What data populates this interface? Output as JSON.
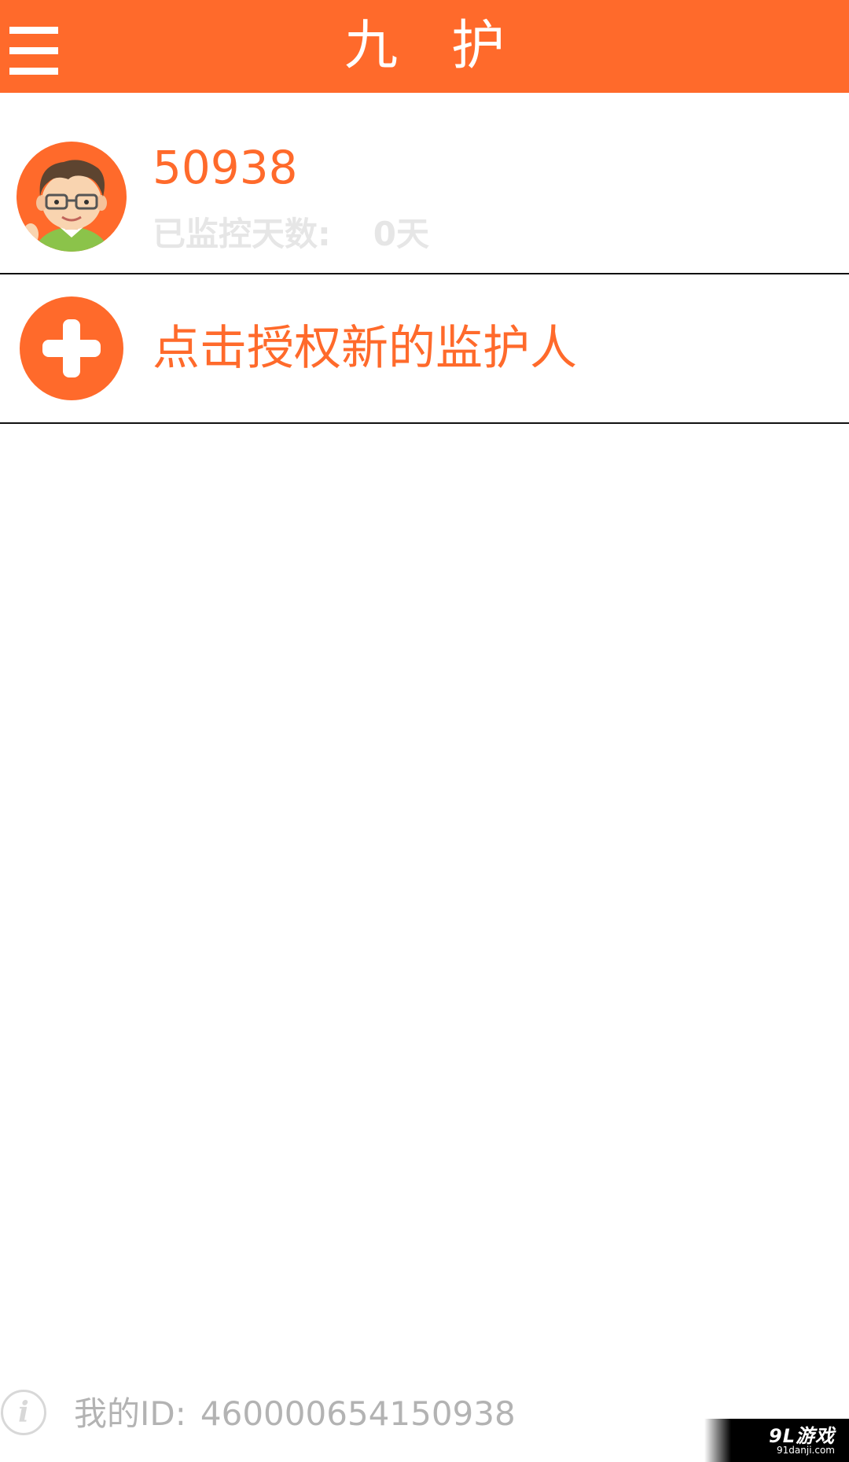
{
  "header": {
    "title": "九护",
    "menu_icon": "menu-icon"
  },
  "user": {
    "name": "50938",
    "days_label": "已监控天数:",
    "days_value": "0天",
    "avatar_icon": "avatar-old-man-glasses"
  },
  "add_guardian": {
    "label": "点击授权新的监护人",
    "icon": "plus-icon"
  },
  "footer": {
    "id_label": "我的ID:",
    "id_value": "460000654150938",
    "icon": "info-icon"
  },
  "watermark": {
    "logo": "9L游戏",
    "url": "91danji.com"
  },
  "colors": {
    "accent": "#ff6a2b",
    "muted_text": "#b3b3b3",
    "faded_text": "#e6e6e6"
  }
}
